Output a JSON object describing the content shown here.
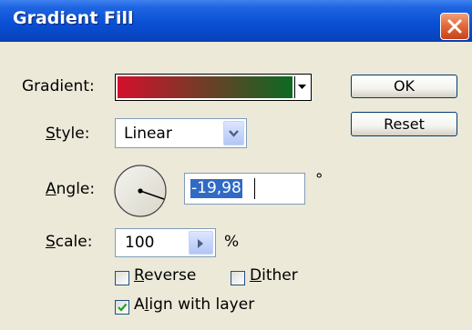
{
  "window": {
    "title": "Gradient Fill",
    "close_icon": "close-icon"
  },
  "gradient": {
    "label": "Gradient:",
    "start_color": "#d4102c",
    "end_color": "#0c6a22"
  },
  "style": {
    "label": "Style:",
    "value": "Linear"
  },
  "angle": {
    "label": "Angle:",
    "value": "-19,98",
    "unit": "°"
  },
  "scale": {
    "label": "Scale:",
    "value": "100",
    "unit": "%"
  },
  "options": {
    "reverse": {
      "label": "Reverse",
      "checked": false
    },
    "dither": {
      "label": "Dither",
      "checked": false
    },
    "align": {
      "label": "Align with layer",
      "checked": true
    }
  },
  "buttons": {
    "ok": "OK",
    "reset": "Reset"
  },
  "colors": {
    "titlebar": "#0a50d6",
    "dialog_bg": "#ece9d8",
    "selection": "#316ac5"
  }
}
